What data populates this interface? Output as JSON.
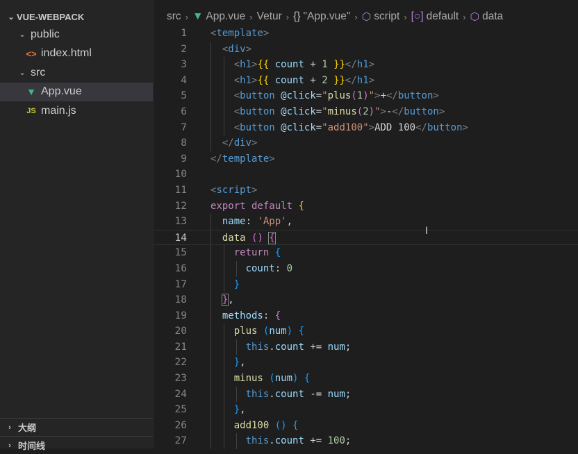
{
  "sidebar": {
    "title": "VUE-WEBPACK",
    "items": [
      {
        "label": "public",
        "type": "folder"
      },
      {
        "label": "index.html",
        "type": "html"
      },
      {
        "label": "src",
        "type": "folder"
      },
      {
        "label": "App.vue",
        "type": "vue",
        "active": true
      },
      {
        "label": "main.js",
        "type": "js"
      }
    ],
    "outline_label": "大纲",
    "timeline_label": "时间线",
    "icons": {
      "chevron": "chevron-icon",
      "html": "html-file-icon",
      "vue": "vue-file-icon",
      "js": "js-file-icon"
    }
  },
  "breadcrumb": {
    "items": [
      "src",
      "App.vue",
      "Vetur",
      "\"App.vue\"",
      "script",
      "default",
      "data"
    ]
  },
  "editor": {
    "current_line": 14,
    "lines": [
      {
        "n": "1",
        "tokens": [
          [
            "t-punct",
            "<"
          ],
          [
            "t-tag",
            "template"
          ],
          [
            "t-punct",
            ">"
          ]
        ]
      },
      {
        "n": "2",
        "tokens": [
          [
            "t-text",
            "  "
          ],
          [
            "t-punct",
            "<"
          ],
          [
            "t-tag",
            "div"
          ],
          [
            "t-punct",
            ">"
          ]
        ]
      },
      {
        "n": "3",
        "tokens": [
          [
            "t-text",
            "    "
          ],
          [
            "t-punct",
            "<"
          ],
          [
            "t-tag",
            "h1"
          ],
          [
            "t-punct",
            ">"
          ],
          [
            "t-brace-y",
            "{{"
          ],
          [
            "t-attr",
            " count "
          ],
          [
            "t-text",
            "+ "
          ],
          [
            "t-num",
            "1"
          ],
          [
            "t-text",
            " "
          ],
          [
            "t-brace-y",
            "}}"
          ],
          [
            "t-punct",
            "</"
          ],
          [
            "t-tag",
            "h1"
          ],
          [
            "t-punct",
            ">"
          ]
        ]
      },
      {
        "n": "4",
        "tokens": [
          [
            "t-text",
            "    "
          ],
          [
            "t-punct",
            "<"
          ],
          [
            "t-tag",
            "h1"
          ],
          [
            "t-punct",
            ">"
          ],
          [
            "t-brace-y",
            "{{"
          ],
          [
            "t-attr",
            " count "
          ],
          [
            "t-text",
            "+ "
          ],
          [
            "t-num",
            "2"
          ],
          [
            "t-text",
            " "
          ],
          [
            "t-brace-y",
            "}}"
          ],
          [
            "t-punct",
            "</"
          ],
          [
            "t-tag",
            "h1"
          ],
          [
            "t-punct",
            ">"
          ]
        ]
      },
      {
        "n": "5",
        "tokens": [
          [
            "t-text",
            "    "
          ],
          [
            "t-punct",
            "<"
          ],
          [
            "t-tag",
            "button"
          ],
          [
            "t-text",
            " "
          ],
          [
            "t-attr",
            "@click"
          ],
          [
            "t-text",
            "="
          ],
          [
            "t-str",
            "\""
          ],
          [
            "t-fn",
            "plus"
          ],
          [
            "t-brace-p",
            "("
          ],
          [
            "t-num",
            "1"
          ],
          [
            "t-brace-p",
            ")"
          ],
          [
            "t-str",
            "\""
          ],
          [
            "t-punct",
            ">"
          ],
          [
            "t-text",
            "+"
          ],
          [
            "t-punct",
            "</"
          ],
          [
            "t-tag",
            "button"
          ],
          [
            "t-punct",
            ">"
          ]
        ]
      },
      {
        "n": "6",
        "tokens": [
          [
            "t-text",
            "    "
          ],
          [
            "t-punct",
            "<"
          ],
          [
            "t-tag",
            "button"
          ],
          [
            "t-text",
            " "
          ],
          [
            "t-attr",
            "@click"
          ],
          [
            "t-text",
            "="
          ],
          [
            "t-str",
            "\""
          ],
          [
            "t-fn",
            "minus"
          ],
          [
            "t-brace-p",
            "("
          ],
          [
            "t-num",
            "2"
          ],
          [
            "t-brace-p",
            ")"
          ],
          [
            "t-str",
            "\""
          ],
          [
            "t-punct",
            ">"
          ],
          [
            "t-text",
            "-"
          ],
          [
            "t-punct",
            "</"
          ],
          [
            "t-tag",
            "button"
          ],
          [
            "t-punct",
            ">"
          ]
        ]
      },
      {
        "n": "7",
        "tokens": [
          [
            "t-text",
            "    "
          ],
          [
            "t-punct",
            "<"
          ],
          [
            "t-tag",
            "button"
          ],
          [
            "t-text",
            " "
          ],
          [
            "t-attr",
            "@click"
          ],
          [
            "t-text",
            "="
          ],
          [
            "t-str",
            "\"add100\""
          ],
          [
            "t-punct",
            ">"
          ],
          [
            "t-text",
            "ADD 100"
          ],
          [
            "t-punct",
            "</"
          ],
          [
            "t-tag",
            "button"
          ],
          [
            "t-punct",
            ">"
          ]
        ]
      },
      {
        "n": "8",
        "tokens": [
          [
            "t-text",
            "  "
          ],
          [
            "t-punct",
            "</"
          ],
          [
            "t-tag",
            "div"
          ],
          [
            "t-punct",
            ">"
          ]
        ]
      },
      {
        "n": "9",
        "tokens": [
          [
            "t-punct",
            "</"
          ],
          [
            "t-tag",
            "template"
          ],
          [
            "t-punct",
            ">"
          ]
        ]
      },
      {
        "n": "10",
        "tokens": []
      },
      {
        "n": "11",
        "tokens": [
          [
            "t-punct",
            "<"
          ],
          [
            "t-tag",
            "script"
          ],
          [
            "t-punct",
            ">"
          ]
        ]
      },
      {
        "n": "12",
        "tokens": [
          [
            "t-kw",
            "export default "
          ],
          [
            "t-brace-y",
            "{"
          ]
        ]
      },
      {
        "n": "13",
        "tokens": [
          [
            "t-text",
            "  "
          ],
          [
            "t-attr",
            "name"
          ],
          [
            "t-text",
            ": "
          ],
          [
            "t-str",
            "'App'"
          ],
          [
            "t-text",
            ","
          ]
        ]
      },
      {
        "n": "14",
        "tokens": [
          [
            "t-text",
            "  "
          ],
          [
            "t-fn",
            "data"
          ],
          [
            "t-text",
            " "
          ],
          [
            "t-brace-p",
            "()"
          ],
          [
            "t-text",
            " "
          ],
          [
            "t-brace-p bracket-box",
            "{"
          ]
        ]
      },
      {
        "n": "15",
        "tokens": [
          [
            "t-text",
            "    "
          ],
          [
            "t-kw",
            "return"
          ],
          [
            "t-text",
            " "
          ],
          [
            "t-brace-b",
            "{"
          ]
        ]
      },
      {
        "n": "16",
        "tokens": [
          [
            "t-text",
            "      "
          ],
          [
            "t-attr",
            "count"
          ],
          [
            "t-text",
            ": "
          ],
          [
            "t-num",
            "0"
          ]
        ]
      },
      {
        "n": "17",
        "tokens": [
          [
            "t-text",
            "    "
          ],
          [
            "t-brace-b",
            "}"
          ]
        ]
      },
      {
        "n": "18",
        "tokens": [
          [
            "t-text",
            "  "
          ],
          [
            "t-brace-p bracket-box",
            "}"
          ],
          [
            "t-text",
            ","
          ]
        ]
      },
      {
        "n": "19",
        "tokens": [
          [
            "t-text",
            "  "
          ],
          [
            "t-attr",
            "methods"
          ],
          [
            "t-text",
            ": "
          ],
          [
            "t-brace-p",
            "{"
          ]
        ]
      },
      {
        "n": "20",
        "tokens": [
          [
            "t-text",
            "    "
          ],
          [
            "t-fn",
            "plus"
          ],
          [
            "t-text",
            " "
          ],
          [
            "t-brace-b",
            "("
          ],
          [
            "t-attr",
            "num"
          ],
          [
            "t-brace-b",
            ")"
          ],
          [
            "t-text",
            " "
          ],
          [
            "t-brace-b",
            "{"
          ]
        ]
      },
      {
        "n": "21",
        "tokens": [
          [
            "t-text",
            "      "
          ],
          [
            "t-this",
            "this"
          ],
          [
            "t-text",
            "."
          ],
          [
            "t-attr",
            "count"
          ],
          [
            "t-text",
            " += "
          ],
          [
            "t-attr",
            "num"
          ],
          [
            "t-text",
            ";"
          ]
        ]
      },
      {
        "n": "22",
        "tokens": [
          [
            "t-text",
            "    "
          ],
          [
            "t-brace-b",
            "}"
          ],
          [
            "t-text",
            ","
          ]
        ]
      },
      {
        "n": "23",
        "tokens": [
          [
            "t-text",
            "    "
          ],
          [
            "t-fn",
            "minus"
          ],
          [
            "t-text",
            " "
          ],
          [
            "t-brace-b",
            "("
          ],
          [
            "t-attr",
            "num"
          ],
          [
            "t-brace-b",
            ")"
          ],
          [
            "t-text",
            " "
          ],
          [
            "t-brace-b",
            "{"
          ]
        ]
      },
      {
        "n": "24",
        "tokens": [
          [
            "t-text",
            "      "
          ],
          [
            "t-this",
            "this"
          ],
          [
            "t-text",
            "."
          ],
          [
            "t-attr",
            "count"
          ],
          [
            "t-text",
            " -= "
          ],
          [
            "t-attr",
            "num"
          ],
          [
            "t-text",
            ";"
          ]
        ]
      },
      {
        "n": "25",
        "tokens": [
          [
            "t-text",
            "    "
          ],
          [
            "t-brace-b",
            "}"
          ],
          [
            "t-text",
            ","
          ]
        ]
      },
      {
        "n": "26",
        "tokens": [
          [
            "t-text",
            "    "
          ],
          [
            "t-fn",
            "add100"
          ],
          [
            "t-text",
            " "
          ],
          [
            "t-brace-b",
            "()"
          ],
          [
            "t-text",
            " "
          ],
          [
            "t-brace-b",
            "{"
          ]
        ]
      },
      {
        "n": "27",
        "tokens": [
          [
            "t-text",
            "      "
          ],
          [
            "t-this",
            "this"
          ],
          [
            "t-text",
            "."
          ],
          [
            "t-attr",
            "count"
          ],
          [
            "t-text",
            " += "
          ],
          [
            "t-num",
            "100"
          ],
          [
            "t-text",
            ";"
          ]
        ]
      }
    ]
  }
}
